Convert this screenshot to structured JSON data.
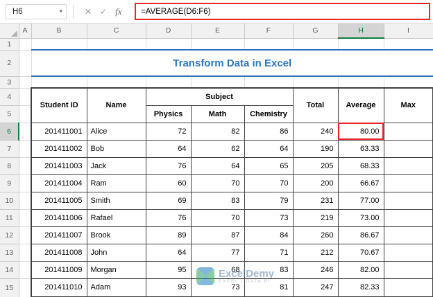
{
  "formula_bar": {
    "name_box_value": "H6",
    "formula": "=AVERAGE(D6:F6)",
    "icons": {
      "dropdown": "▾",
      "cancel": "✕",
      "enter": "✓",
      "fx": "fx"
    },
    "annotation_red": "#e8272c"
  },
  "grid": {
    "column_headers": [
      "A",
      "B",
      "C",
      "D",
      "E",
      "F",
      "G",
      "H",
      "I"
    ],
    "row_headers": [
      "1",
      "2",
      "3",
      "4",
      "5",
      "6",
      "7",
      "8",
      "9",
      "10",
      "11",
      "12",
      "13",
      "14",
      "15"
    ],
    "selected_column": "H",
    "selected_row": "6",
    "selection_green": "#107c41"
  },
  "sheet": {
    "title": "Transform Data in Excel",
    "title_blue": "#2e75b6"
  },
  "table": {
    "headers": {
      "student_id": "Student ID",
      "name": "Name",
      "subject": "Subject",
      "physics": "Physics",
      "math": "Math",
      "chemistry": "Chemistry",
      "total": "Total",
      "average": "Average",
      "max": "Max"
    },
    "rows": [
      {
        "id": "201411001",
        "name": "Alice",
        "physics": "72",
        "math": "82",
        "chemistry": "86",
        "total": "240",
        "average": "80.00",
        "max": ""
      },
      {
        "id": "201411002",
        "name": "Bob",
        "physics": "64",
        "math": "62",
        "chemistry": "64",
        "total": "190",
        "average": "63.33",
        "max": ""
      },
      {
        "id": "201411003",
        "name": "Jack",
        "physics": "76",
        "math": "64",
        "chemistry": "65",
        "total": "205",
        "average": "68.33",
        "max": ""
      },
      {
        "id": "201411004",
        "name": "Ram",
        "physics": "60",
        "math": "70",
        "chemistry": "70",
        "total": "200",
        "average": "66.67",
        "max": ""
      },
      {
        "id": "201411005",
        "name": "Smith",
        "physics": "69",
        "math": "83",
        "chemistry": "79",
        "total": "231",
        "average": "77.00",
        "max": ""
      },
      {
        "id": "201411006",
        "name": "Rafael",
        "physics": "76",
        "math": "70",
        "chemistry": "73",
        "total": "219",
        "average": "73.00",
        "max": ""
      },
      {
        "id": "201411007",
        "name": "Brook",
        "physics": "89",
        "math": "87",
        "chemistry": "84",
        "total": "260",
        "average": "86.67",
        "max": ""
      },
      {
        "id": "201411008",
        "name": "John",
        "physics": "64",
        "math": "77",
        "chemistry": "71",
        "total": "212",
        "average": "70.67",
        "max": ""
      },
      {
        "id": "201411009",
        "name": "Morgan",
        "physics": "95",
        "math": "68",
        "chemistry": "83",
        "total": "246",
        "average": "82.00",
        "max": ""
      },
      {
        "id": "201411010",
        "name": "Adam",
        "physics": "93",
        "math": "73",
        "chemistry": "81",
        "total": "247",
        "average": "82.33",
        "max": ""
      }
    ]
  },
  "watermark": {
    "brand": "ExcelDemy",
    "tagline": "EXCEL · DATA BI"
  }
}
